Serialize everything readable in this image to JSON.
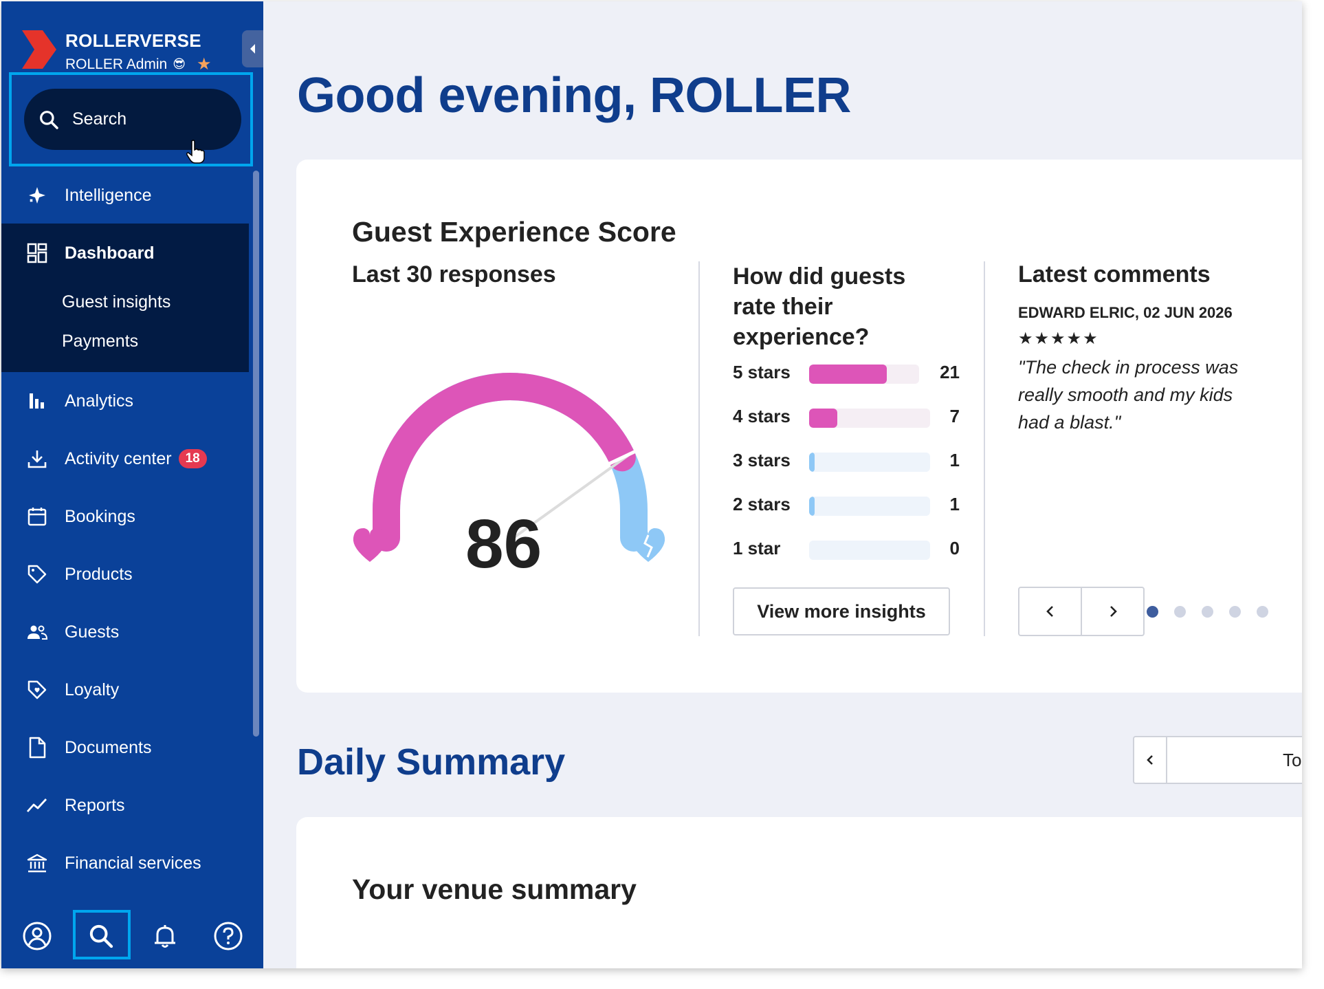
{
  "sidebar": {
    "brand_name": "ROLLERVERSE",
    "brand_sub": "ROLLER Admin",
    "brand_emoji": "😎",
    "brand_star": "★",
    "search_label": "Search",
    "items": [
      {
        "label": "Intelligence"
      },
      {
        "label": "Dashboard"
      },
      {
        "label": "Analytics"
      },
      {
        "label": "Activity center",
        "badge": "18"
      },
      {
        "label": "Bookings"
      },
      {
        "label": "Products"
      },
      {
        "label": "Guests"
      },
      {
        "label": "Loyalty"
      },
      {
        "label": "Documents"
      },
      {
        "label": "Reports"
      },
      {
        "label": "Financial services"
      }
    ],
    "dashboard_sub": [
      "Guest insights",
      "Payments"
    ]
  },
  "main": {
    "greeting": "Good evening, ROLLER",
    "guest_experience": {
      "title": "Guest Experience Score",
      "subtitle": "Last 30 responses",
      "score": "86",
      "score_fraction": 0.86
    },
    "ratings": {
      "title": "How did guests rate their experience?",
      "rows": [
        {
          "label": "5 stars",
          "count": "21",
          "value": 21
        },
        {
          "label": "4 stars",
          "count": "7",
          "value": 7
        },
        {
          "label": "3 stars",
          "count": "1",
          "value": 1
        },
        {
          "label": "2 stars",
          "count": "1",
          "value": 1
        },
        {
          "label": "1 star",
          "count": "0",
          "value": 0
        }
      ],
      "button": "View more insights"
    },
    "comments": {
      "title": "Latest comments",
      "author": "EDWARD ELRIC, 02 JUN 2026",
      "stars": "★★★★★",
      "text": "\"The check in process was really smooth and my kids had a blast.\"",
      "active_dot": 1,
      "dot_count": 5
    },
    "daily_summary": {
      "title": "Daily Summary",
      "date_label": "To"
    },
    "venue_summary": {
      "title": "Your venue summary"
    }
  },
  "colors": {
    "sidebar_bg": "#0a4199",
    "sidebar_active": "#021b44",
    "accent_pink": "#dd55b8",
    "accent_light_blue": "#8ec8f6",
    "heading_blue": "#0f3d8c",
    "highlight_cyan": "#00a6ee",
    "badge_red": "#e53951"
  }
}
